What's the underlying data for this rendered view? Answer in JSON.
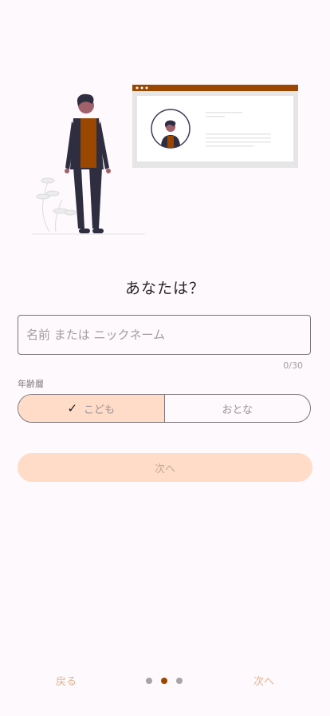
{
  "colors": {
    "accent": "#9b4700",
    "primary_container": "#ffdcc7",
    "background": "#fdf9fc",
    "outline": "#7c7479"
  },
  "illustration": {
    "icon": "person-presenting-profile-illustration"
  },
  "title": "あなたは？",
  "name_field": {
    "placeholder": "名前 または ニックネーム",
    "value": "",
    "counter": "0/30"
  },
  "age_group": {
    "label": "年齢層",
    "options": [
      {
        "label": "こども",
        "selected": true,
        "icon": "check-icon"
      },
      {
        "label": "おとな",
        "selected": false
      }
    ]
  },
  "next_button": {
    "label": "次へ",
    "enabled": false
  },
  "bottom_nav": {
    "back_label": "戻る",
    "next_label": "次へ",
    "page_count": 3,
    "current_page": 2
  }
}
